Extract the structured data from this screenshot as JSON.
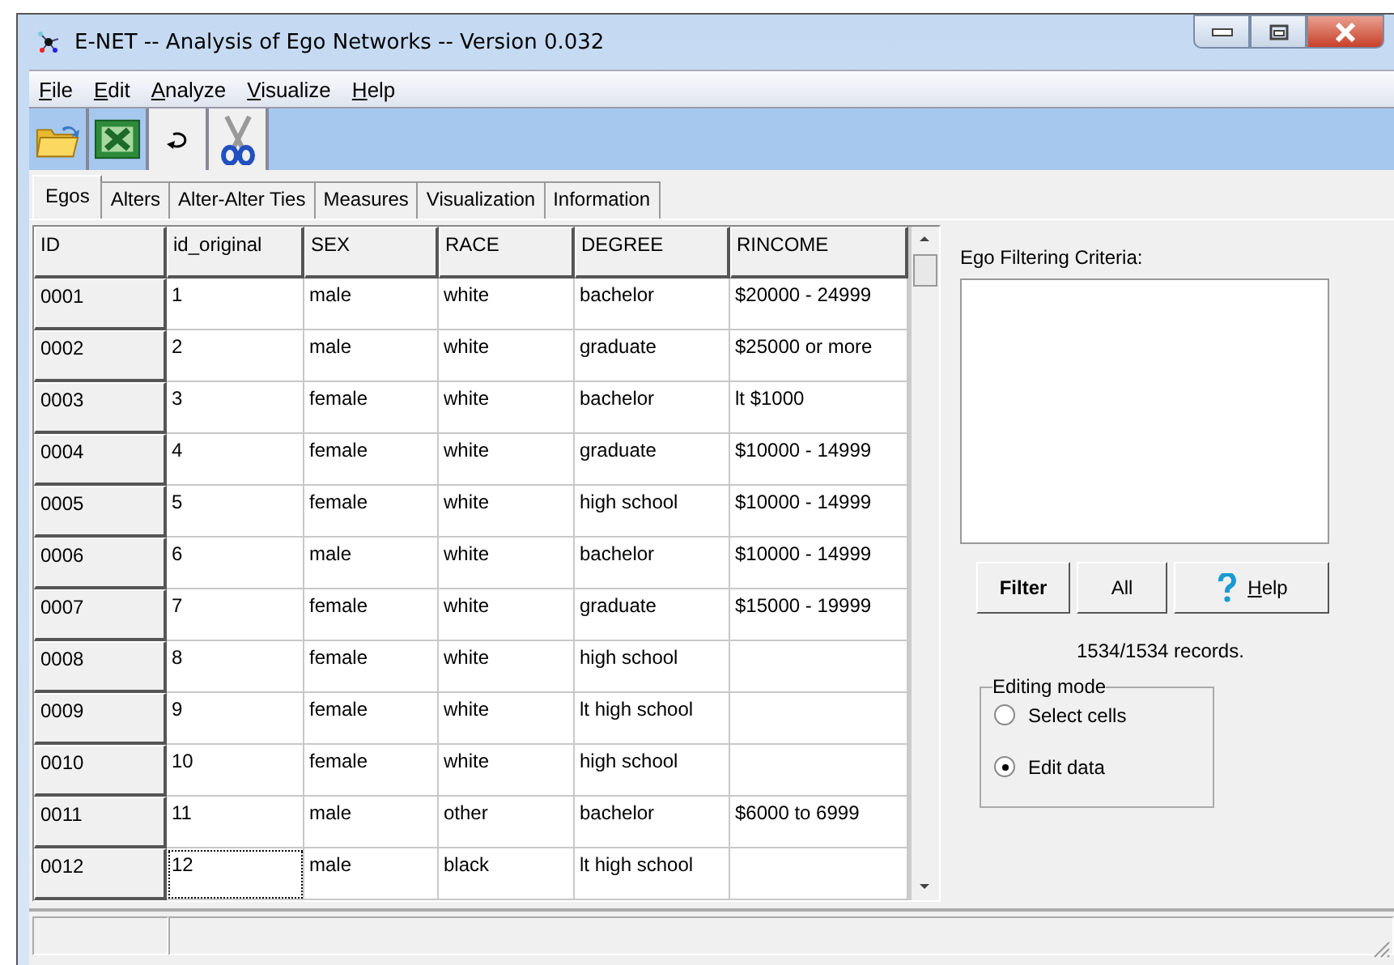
{
  "window": {
    "title": "E-NET -- Analysis of Ego Networks -- Version 0.032"
  },
  "menu": [
    "File",
    "Edit",
    "Analyze",
    "Visualize",
    "Help"
  ],
  "tabs": [
    {
      "label": "Egos",
      "selected": true
    },
    {
      "label": "Alters",
      "selected": false
    },
    {
      "label": "Alter-Alter Ties",
      "selected": false
    },
    {
      "label": "Measures",
      "selected": false
    },
    {
      "label": "Visualization",
      "selected": false
    },
    {
      "label": "Information",
      "selected": false
    }
  ],
  "table": {
    "columns": [
      "ID",
      "id_original",
      "SEX",
      "RACE",
      "DEGREE",
      "RINCOME"
    ],
    "rows": [
      {
        "cells": [
          "0001",
          "1",
          "male",
          "white",
          "bachelor",
          "$20000 - 24999"
        ],
        "focused": false
      },
      {
        "cells": [
          "0002",
          "2",
          "male",
          "white",
          "graduate",
          "$25000 or more"
        ],
        "focused": false
      },
      {
        "cells": [
          "0003",
          "3",
          "female",
          "white",
          "bachelor",
          "lt $1000"
        ],
        "focused": false
      },
      {
        "cells": [
          "0004",
          "4",
          "female",
          "white",
          "graduate",
          "$10000 - 14999"
        ],
        "focused": false
      },
      {
        "cells": [
          "0005",
          "5",
          "female",
          "white",
          "high school",
          "$10000 - 14999"
        ],
        "focused": false
      },
      {
        "cells": [
          "0006",
          "6",
          "male",
          "white",
          "bachelor",
          "$10000 - 14999"
        ],
        "focused": false
      },
      {
        "cells": [
          "0007",
          "7",
          "female",
          "white",
          "graduate",
          "$15000 - 19999"
        ],
        "focused": false
      },
      {
        "cells": [
          "0008",
          "8",
          "female",
          "white",
          "high school",
          ""
        ],
        "focused": false
      },
      {
        "cells": [
          "0009",
          "9",
          "female",
          "white",
          "lt high school",
          ""
        ],
        "focused": false
      },
      {
        "cells": [
          "0010",
          "10",
          "female",
          "white",
          "high school",
          ""
        ],
        "focused": false
      },
      {
        "cells": [
          "0011",
          "11",
          "male",
          "other",
          "bachelor",
          "$6000 to 6999"
        ],
        "focused": false
      },
      {
        "cells": [
          "0012",
          "12",
          "male",
          "black",
          "lt high school",
          ""
        ],
        "focused": true
      }
    ]
  },
  "filter": {
    "label": "Ego Filtering Criteria:",
    "buttons": [
      {
        "label": "Filter",
        "kind": "bold"
      },
      {
        "label": "All",
        "kind": "plain"
      },
      {
        "label": "Help",
        "kind": "help"
      }
    ],
    "records": "1534/1534 records."
  },
  "editing_mode": {
    "label": "Editing mode",
    "options": [
      {
        "label": "Select cells",
        "selected": false
      },
      {
        "label": "Edit data",
        "selected": true
      }
    ]
  }
}
